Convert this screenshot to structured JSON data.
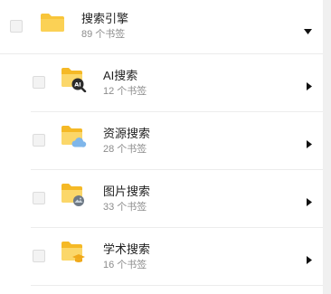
{
  "colors": {
    "folder": "#f8c53a",
    "folder_light": "#fbd76a",
    "divider": "#ececec",
    "title_text": "#222222",
    "count_text": "#8c8c8c"
  },
  "group": {
    "title": "搜索引擎",
    "count": "89 个书签",
    "caret_icon": "caret-down-icon",
    "folder_icon": "folder-icon"
  },
  "items": [
    {
      "title": "AI搜索",
      "count": "12 个书签",
      "badge_icon": "ai-search-badge-icon",
      "caret_icon": "caret-right-icon"
    },
    {
      "title": "资源搜索",
      "count": "28 个书签",
      "badge_icon": "cloud-badge-icon",
      "caret_icon": "caret-right-icon"
    },
    {
      "title": "图片搜索",
      "count": "33 个书签",
      "badge_icon": "image-badge-icon",
      "caret_icon": "caret-right-icon"
    },
    {
      "title": "学术搜索",
      "count": "16 个书签",
      "badge_icon": "graduation-cap-badge-icon",
      "caret_icon": "caret-right-icon"
    }
  ]
}
